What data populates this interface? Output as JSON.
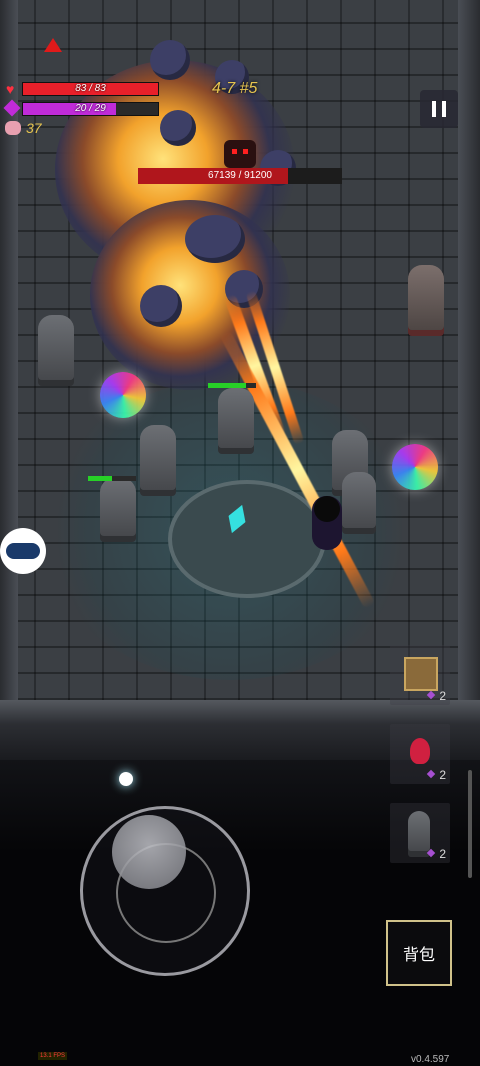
{
  "hud": {
    "hp_text": "83 / 83",
    "hp_fraction": 1.0,
    "mana_text": "20 / 29",
    "mana_fraction": 0.69,
    "coins": "37",
    "stage": "4-7 #5",
    "hp_color": "#e8202a",
    "mana_color": "#c02bd9",
    "coin_color": "#e6c44f"
  },
  "boss": {
    "hp_text": "67139 / 91200",
    "hp_fraction": 0.736
  },
  "enemies": [
    {
      "hp_fraction": 0.8
    },
    {
      "hp_fraction": 0.5
    }
  ],
  "inventory": [
    {
      "icon": "crate-icon",
      "count": "2"
    },
    {
      "icon": "potion-icon",
      "count": "2"
    },
    {
      "icon": "statue-icon",
      "count": "2"
    }
  ],
  "bag_label": "背包",
  "fps": "13.1 FPS",
  "version": "v0.4.597"
}
